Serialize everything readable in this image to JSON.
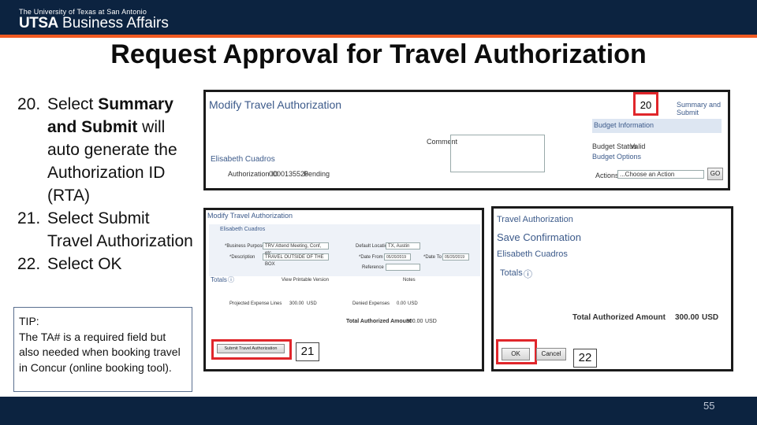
{
  "header": {
    "university": "The University of Texas at San Antonio",
    "brand_strong": "UTSA",
    "brand_rest": "Business Affairs"
  },
  "title": "Request Approval for Travel Authorization",
  "steps": [
    {
      "num": "20.",
      "pre": "Select ",
      "bold": "Summary and Submit",
      "post": " will auto generate the Authorization ID (RTA)"
    },
    {
      "num": "21.",
      "pre": "Select Submit Travel Authorization",
      "bold": "",
      "post": ""
    },
    {
      "num": "22.",
      "pre": "Select OK",
      "bold": "",
      "post": ""
    }
  ],
  "tip": {
    "heading": "TIP:",
    "body": "The TA# is a required field but also needed when booking travel in Concur (online booking tool)."
  },
  "screen1": {
    "title": "Modify Travel Authorization",
    "employee": "Elisabeth Cuadros",
    "auth_label": "Authorization ID",
    "auth_value": "0000135526",
    "status": "Pending",
    "comment_label": "Comment",
    "budget_header": "Budget Information",
    "budget_status": "Budget Status",
    "budget_status_value": "Valid",
    "budget_options": "Budget Options",
    "actions_label": "Actions",
    "actions_value": "...Choose an Action",
    "go_label": "GO",
    "summary_link": "Summary and Submit",
    "step_number": "20"
  },
  "screen2": {
    "title": "Modify Travel Authorization",
    "employee": "Elisabeth Cuadros",
    "business_purpose_label": "*Business Purpose",
    "business_purpose_value": "TRV Attend Meeting, Conf, etc.",
    "description_label": "*Description",
    "description_value": "TRAVEL OUTSIDE OF THE BOX",
    "default_location_label": "Default Location",
    "default_location_value": "TX, Austin",
    "date_from_label": "*Date From",
    "date_from_value": "05/20/2019",
    "date_to_label": "*Date To",
    "date_to_value": "05/20/2019",
    "reference_label": "Reference",
    "totals_label": "Totals",
    "view_printable": "View Printable Version",
    "notes_label": "Notes",
    "projected_label": "Projected Expense Lines",
    "projected_value": "300.00",
    "projected_currency": "USD",
    "denied_label": "Denied Expenses",
    "denied_value": "0.00",
    "denied_currency": "USD",
    "total_label": "Total Authorized Amount",
    "total_value": "300.00",
    "total_currency": "USD",
    "submit_button": "Submit Travel Authorization",
    "step_number": "21"
  },
  "screen3": {
    "title": "Travel Authorization",
    "save_confirmation": "Save Confirmation",
    "employee": "Elisabeth Cuadros",
    "totals_label": "Totals",
    "total_label": "Total Authorized Amount",
    "total_value": "300.00",
    "total_currency": "USD",
    "ok_button": "OK",
    "cancel_button": "Cancel",
    "step_number": "22"
  },
  "footer": {
    "page_number": "55"
  },
  "colors": {
    "navy": "#0c2340",
    "orange": "#f15a22",
    "callout_red": "#e0262b",
    "peoplesoft_blue": "#3c5a8a"
  }
}
